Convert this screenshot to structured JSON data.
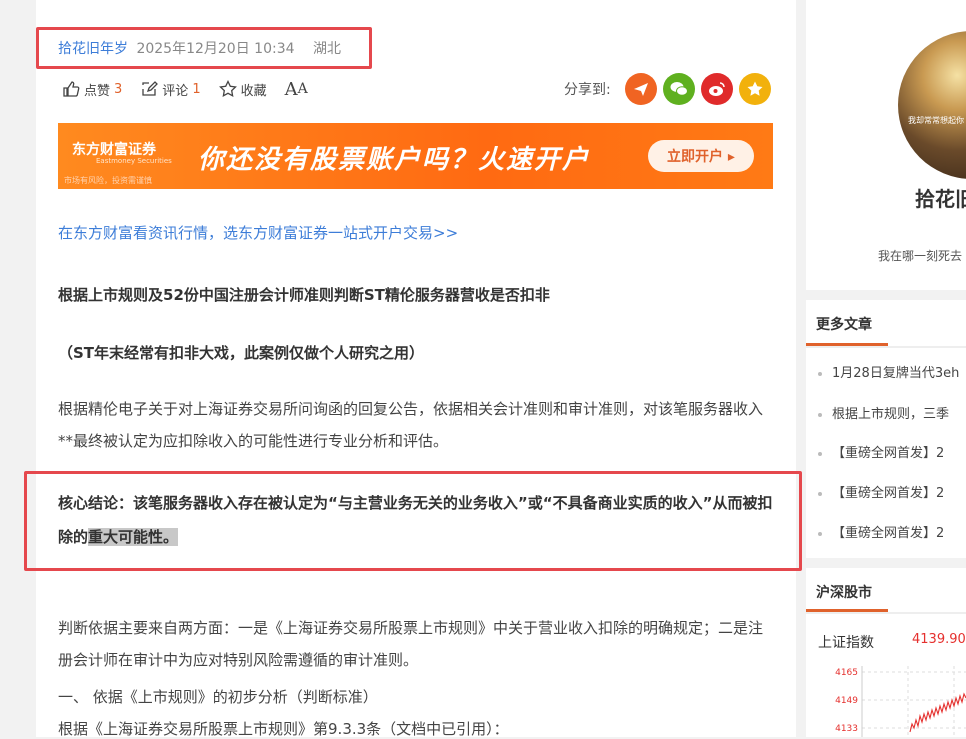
{
  "article": {
    "author": "拾花旧年岁",
    "date": "2025年12月20日 10:34",
    "location": "湖北",
    "like_label": "点赞",
    "like_count": "3",
    "comment_label": "评论",
    "comment_count": "1",
    "collect_label": "收藏",
    "font_big": "A",
    "font_small": "A",
    "share_label": "分享到:",
    "banner": {
      "brand": "东方财富证券",
      "brand_en": "Eastmoney Securities",
      "risk": "市场有风险，投资需谨慎",
      "slogan": "你还没有股票账户吗？火速开户",
      "button": "立即开户 ▸"
    },
    "promo_link": "在东方财富看资讯行情，选东方财富证券一站式开户交易>>",
    "title": "根据上市规则及52份中国注册会计师准则判断ST精伦服务器营收是否扣非",
    "subtitle": "（ST年末经常有扣非大戏，此案例仅做个人研究之用）",
    "para1": "根据精伦电子关于对上海证券交易所问询函的回复公告，依据相关会计准则和审计准则，对该笔服务器收入**最终被认定为应扣除收入的可能性进行专业分析和评估。",
    "conclusion_main": "核心结论：该笔服务器收入存在被认定为“与主营业务无关的业务收入”或“不具备商业实质的收入”从而被扣除的",
    "conclusion_highlight": "重大可能性。",
    "para2": "判断依据主要来自两方面：一是《上海证券交易所股票上市规则》中关于营业收入扣除的明确规定；二是注册会计师在审计中为应对特别风险需遵循的审计准则。",
    "heading1": " 一、 依据《上市规则》的初步分析（判断标准）",
    "para3": "根据《上海证券交易所股票上市规则》第9.3.3条（文档中已引用）："
  },
  "sidebar": {
    "avatar_quote": "我却常常想起你\n起",
    "name": "拾花旧",
    "bio": "我在哪一刻死去",
    "more_title": "更多文章",
    "news": [
      "1月28日复牌当代3eh",
      "根据上市规则，三季",
      "【重磅全网首发】2",
      "【重磅全网首发】2",
      "【重磅全网首发】2"
    ],
    "market_title": "沪深股市",
    "index_name": "上证指数",
    "index_value": "4139.90",
    "y_labels": [
      "4165",
      "4149",
      "4133"
    ]
  },
  "colors": {
    "accent": "#e0622c",
    "link": "#3d7dd8",
    "highlight_box": "#e5484d"
  }
}
